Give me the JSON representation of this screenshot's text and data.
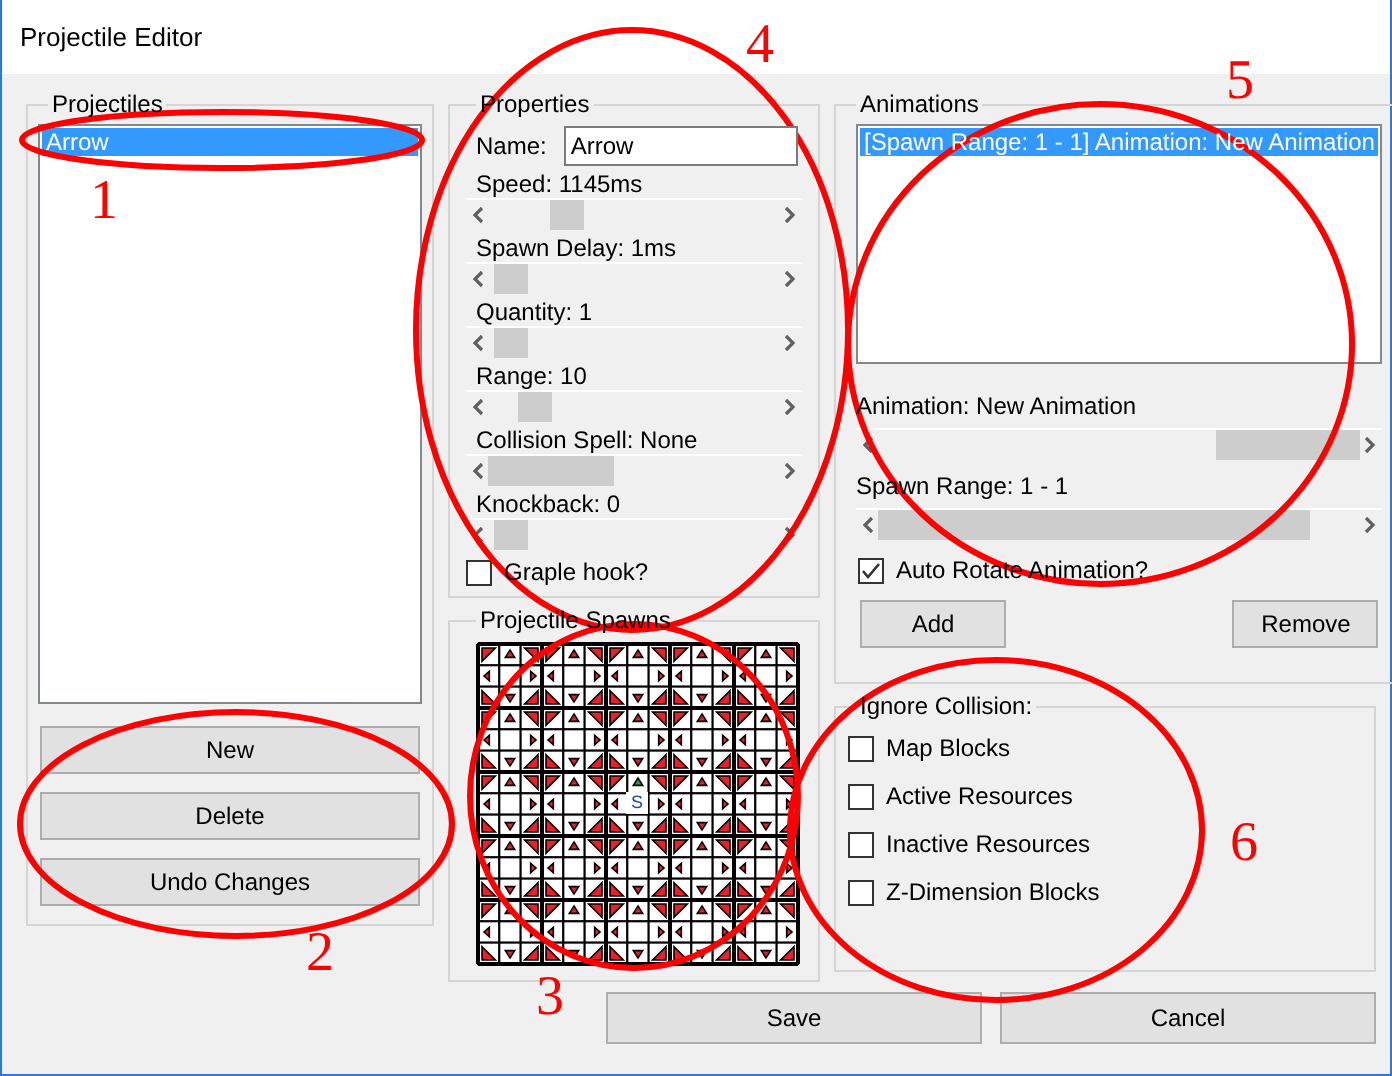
{
  "window": {
    "title": "Projectile Editor"
  },
  "projectiles": {
    "title": "Projectiles",
    "items": [
      {
        "label": "Arrow",
        "selected": true
      }
    ],
    "buttons": [
      "New",
      "Delete",
      "Undo Changes"
    ]
  },
  "properties": {
    "title": "Properties",
    "name_label": "Name:",
    "name_value": "Arrow",
    "sliders": [
      {
        "label": "Speed: 1145ms"
      },
      {
        "label": "Spawn Delay: 1ms"
      },
      {
        "label": "Quantity: 1"
      },
      {
        "label": "Range: 10"
      },
      {
        "label": "Collision Spell: None"
      },
      {
        "label": "Knockback: 0"
      }
    ],
    "graple_hook": {
      "label": "Graple hook?",
      "checked": false
    }
  },
  "spawns": {
    "title": "Projectile Spawns",
    "center_label": "S"
  },
  "animations": {
    "title": "Animations",
    "items": [
      {
        "label": "[Spawn Range: 1 - 1] Animation: New Animation",
        "selected": true
      }
    ],
    "sliders": [
      {
        "label": "Animation: New Animation"
      },
      {
        "label": "Spawn Range: 1 - 1"
      }
    ],
    "auto_rotate": {
      "label": "Auto Rotate Animation?",
      "checked": true
    },
    "buttons": [
      "Add",
      "Remove"
    ]
  },
  "ignore_collision": {
    "title": "Ignore Collision:",
    "options": [
      {
        "label": "Map Blocks",
        "checked": false
      },
      {
        "label": "Active Resources",
        "checked": false
      },
      {
        "label": "Inactive Resources",
        "checked": false
      },
      {
        "label": "Z-Dimension Blocks",
        "checked": false
      }
    ]
  },
  "buttons": [
    "Save",
    "Cancel"
  ],
  "annotations": [
    {
      "label": "1"
    },
    {
      "label": "2"
    },
    {
      "label": "3"
    },
    {
      "label": "4"
    },
    {
      "label": "5"
    },
    {
      "label": "6"
    }
  ]
}
